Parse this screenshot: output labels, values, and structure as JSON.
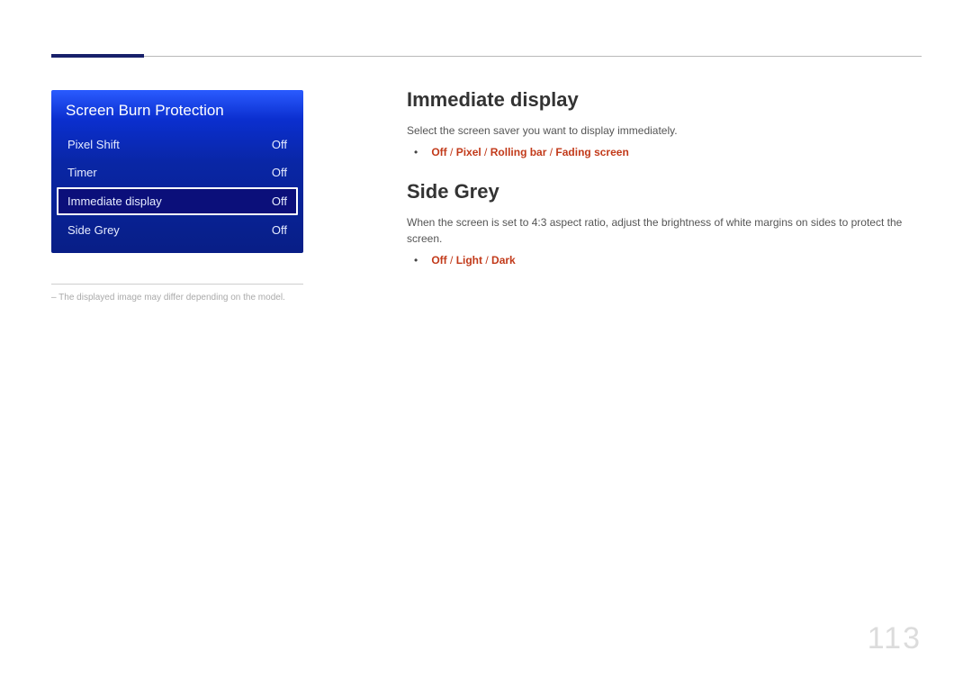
{
  "page_number": "113",
  "panel": {
    "title": "Screen Burn Protection",
    "items": [
      {
        "label": "Pixel Shift",
        "value": "Off",
        "selected": false
      },
      {
        "label": "Timer",
        "value": "Off",
        "selected": false
      },
      {
        "label": "Immediate display",
        "value": "Off",
        "selected": true
      },
      {
        "label": "Side Grey",
        "value": "Off",
        "selected": false
      }
    ]
  },
  "left_note": "The displayed image may differ depending on the model.",
  "sections": [
    {
      "heading": "Immediate display",
      "description": "Select the screen saver you want to display immediately.",
      "options": [
        "Off",
        "Pixel",
        "Rolling bar",
        "Fading screen"
      ]
    },
    {
      "heading": "Side Grey",
      "description": "When the screen is set to 4:3 aspect ratio, adjust the brightness of white margins on sides to protect the screen.",
      "options": [
        "Off",
        "Light",
        "Dark"
      ]
    }
  ]
}
